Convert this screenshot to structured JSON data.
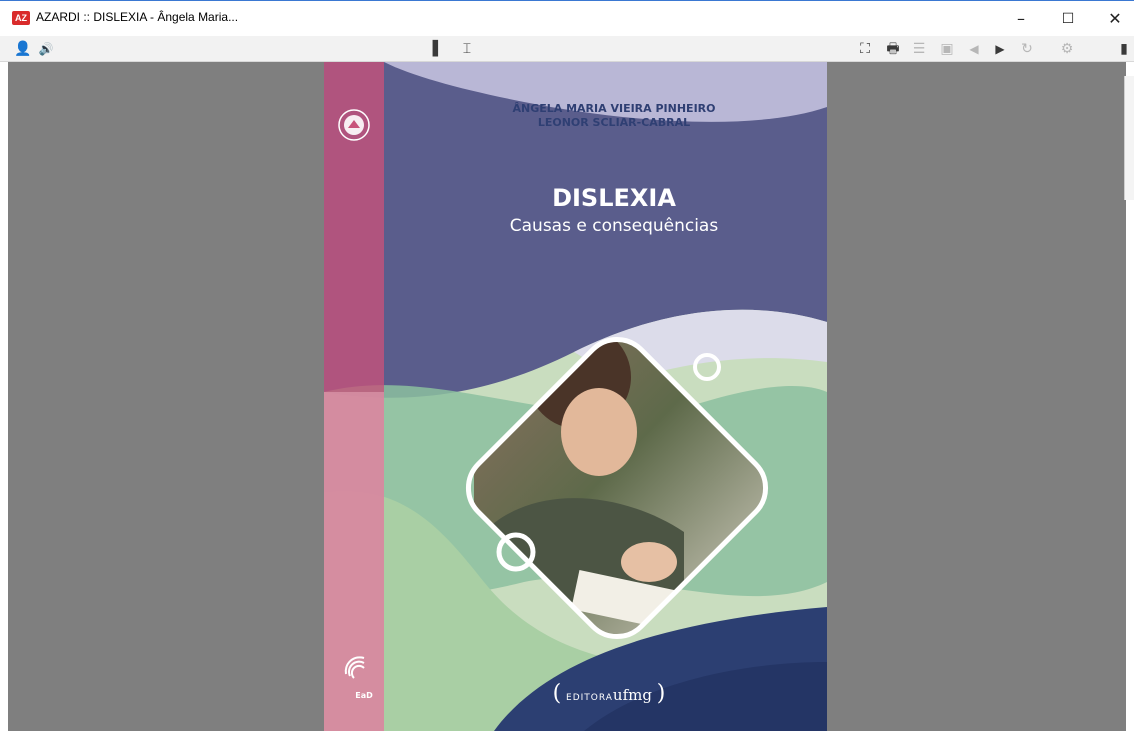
{
  "window": {
    "title": "AZARDI :: DISLEXIA - Ângela Maria...",
    "app_icon_text": "AZ",
    "minimize_glyph": "–",
    "maximize_glyph": "☐",
    "close_glyph": "✕"
  },
  "toolbar": {
    "left_icons": [
      {
        "name": "user-icon",
        "glyph": "👤"
      },
      {
        "name": "speaker-icon",
        "glyph": "🔊"
      }
    ],
    "center_icons": [
      {
        "name": "layout-icon",
        "glyph": "▌"
      },
      {
        "name": "text-width-icon",
        "glyph": "⌶"
      }
    ],
    "right_icons": [
      {
        "name": "fullscreen-icon",
        "glyph": "⛶"
      },
      {
        "name": "print-icon",
        "glyph": "🖶"
      },
      {
        "name": "toc-icon",
        "glyph": "☰"
      },
      {
        "name": "image-icon",
        "glyph": "▣"
      },
      {
        "name": "previous-page-icon",
        "glyph": "◀"
      },
      {
        "name": "next-page-icon",
        "glyph": "▶"
      },
      {
        "name": "refresh-icon",
        "glyph": "↻"
      },
      {
        "name": "settings-icon",
        "glyph": "⚙"
      },
      {
        "name": "library-icon",
        "glyph": "▮"
      }
    ]
  },
  "cover": {
    "author1": "ÂNGELA MARIA VIEIRA PINHEIRO",
    "author2": "LEONOR SCLIAR-CABRAL",
    "title": "DISLEXIA",
    "subtitle": "Causas e consequências",
    "ead_label": "EaD",
    "publisher_prefix": "EDITORA",
    "publisher_name": "ufmg",
    "colors": {
      "purple": "#5a5d8c",
      "pink_spine": "#c8527a",
      "green": "#8cbf9f",
      "navy": "#2c3f72",
      "lavender": "#b9b7d6"
    }
  }
}
